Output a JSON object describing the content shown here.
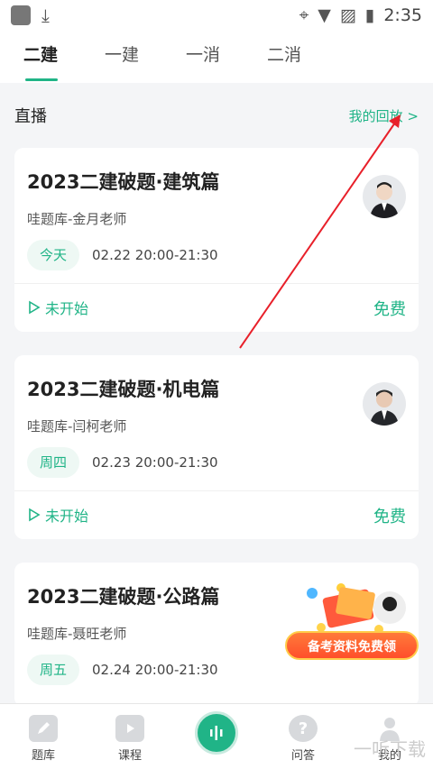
{
  "statusbar": {
    "time": "2:35"
  },
  "tabs": [
    {
      "label": "二建",
      "active": true
    },
    {
      "label": "一建",
      "active": false
    },
    {
      "label": "一消",
      "active": false
    },
    {
      "label": "二消",
      "active": false
    }
  ],
  "section": {
    "title": "直播",
    "replay_link": "我的回放 >"
  },
  "cards": [
    {
      "title": "2023二建破题·建筑篇",
      "teacher": "哇题库-金月老师",
      "day": "今天",
      "time": "02.22  20:00-21:30",
      "status": "未开始",
      "price": "免费"
    },
    {
      "title": "2023二建破题·机电篇",
      "teacher": "哇题库-闫柯老师",
      "day": "周四",
      "time": "02.23  20:00-21:30",
      "status": "未开始",
      "price": "免费"
    },
    {
      "title": "2023二建破题·公路篇",
      "teacher": "哇题库-聂旺老师",
      "day": "周五",
      "time": "02.24  20:00-21:30"
    }
  ],
  "promo": {
    "label": "备考资料免费领"
  },
  "bottomnav": [
    {
      "label": "题库"
    },
    {
      "label": "课程"
    },
    {
      "label": ""
    },
    {
      "label": "问答"
    },
    {
      "label": "我的"
    }
  ],
  "watermark": "一听下载"
}
